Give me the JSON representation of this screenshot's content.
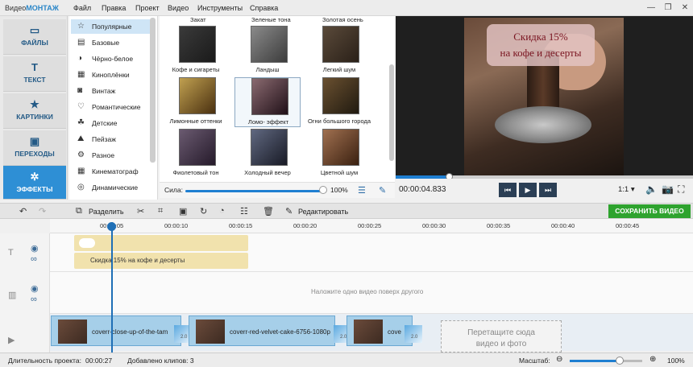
{
  "app": {
    "title_prefix": "Видео",
    "title_brand": "МОНТАЖ"
  },
  "menu": [
    "Файл",
    "Правка",
    "Проект",
    "Видео",
    "Инструменты",
    "Справка"
  ],
  "window_buttons": {
    "minimize": "—",
    "restore": "❐",
    "close": "✕"
  },
  "left_nav": [
    {
      "label": "ФАЙЛЫ",
      "icon": "folder-icon",
      "glyph": "▭"
    },
    {
      "label": "ТЕКСТ",
      "icon": "text-icon",
      "glyph": "T"
    },
    {
      "label": "КАРТИНКИ",
      "icon": "star-icon",
      "glyph": "★"
    },
    {
      "label": "ПЕРЕХОДЫ",
      "icon": "transitions-icon",
      "glyph": "▣"
    },
    {
      "label": "ЭФФЕКТЫ",
      "icon": "effects-icon",
      "glyph": "✲"
    }
  ],
  "categories": [
    {
      "label": "Популярные",
      "glyph": "☆"
    },
    {
      "label": "Базовые",
      "glyph": "▤"
    },
    {
      "label": "Чёрно-белое",
      "glyph": "◑"
    },
    {
      "label": "Киноплёнки",
      "glyph": "▦"
    },
    {
      "label": "Винтаж",
      "glyph": "◙"
    },
    {
      "label": "Романтические",
      "glyph": "♡"
    },
    {
      "label": "Детские",
      "glyph": "☘"
    },
    {
      "label": "Пейзаж",
      "glyph": "⛰"
    },
    {
      "label": "Разное",
      "glyph": "⚙"
    },
    {
      "label": "Кинематограф",
      "glyph": "▦"
    },
    {
      "label": "Динамические",
      "glyph": "◎"
    }
  ],
  "effects_top_labels": [
    "Закат",
    "Зеленые тона",
    "Золотая осень"
  ],
  "effects": [
    {
      "label": "Кофе и сигареты",
      "colors": [
        "#3a3a3a",
        "#1a1a1a"
      ]
    },
    {
      "label": "Ландыш",
      "colors": [
        "#8a8a8a",
        "#3c3c3c"
      ]
    },
    {
      "label": "Легкий шум",
      "colors": [
        "#5a4a3a",
        "#2a2018"
      ]
    },
    {
      "label": "Лимонные оттенки",
      "colors": [
        "#c0a050",
        "#4a3010"
      ]
    },
    {
      "label": "Ломо- эффект",
      "colors": [
        "#8a6a70",
        "#201018"
      ]
    },
    {
      "label": "Огни большого города",
      "colors": [
        "#6a5030",
        "#201a10"
      ]
    },
    {
      "label": "Фиолетовый тон",
      "colors": [
        "#6a5a70",
        "#251a2a"
      ]
    },
    {
      "label": "Холодный вечер",
      "colors": [
        "#606880",
        "#181a25"
      ]
    },
    {
      "label": "Цветной шум",
      "colors": [
        "#a07050",
        "#3a2010"
      ]
    }
  ],
  "strength": {
    "label": "Сила:",
    "value": "100%",
    "level": 1.0
  },
  "preview": {
    "caption_line1": "Скидка 15%",
    "caption_line2": "на кофе и десерты",
    "timecode": "00:00:04.833",
    "zoom": "1:1",
    "progress": 0.18
  },
  "toolbar": {
    "split": "Разделить",
    "edit": "Редактировать",
    "save": "СОХРАНИТЬ ВИДЕО"
  },
  "ruler": [
    "00:00:05",
    "00:00:10",
    "00:00:15",
    "00:00:20",
    "00:00:25",
    "00:00:30",
    "00:00:35",
    "00:00:40",
    "00:00:45"
  ],
  "tracks": {
    "text_clip": "Скидка 15%  на кофе и десерты",
    "overlay_hint": "Наложите одно видео поверх другого",
    "clips": [
      "coverr-close-up-of-the-tam",
      "coverr-red-velvet-cake-6756-1080p",
      "cove"
    ],
    "transition_duration": "2.0",
    "dropzone_line1": "Перетащите сюда",
    "dropzone_line2": "видео и фото"
  },
  "status": {
    "duration_label": "Длительность проекта:",
    "duration": "00:00:27",
    "clips_added": "Добавлено клипов: 3",
    "scale_label": "Масштаб:",
    "scale": "100%"
  }
}
